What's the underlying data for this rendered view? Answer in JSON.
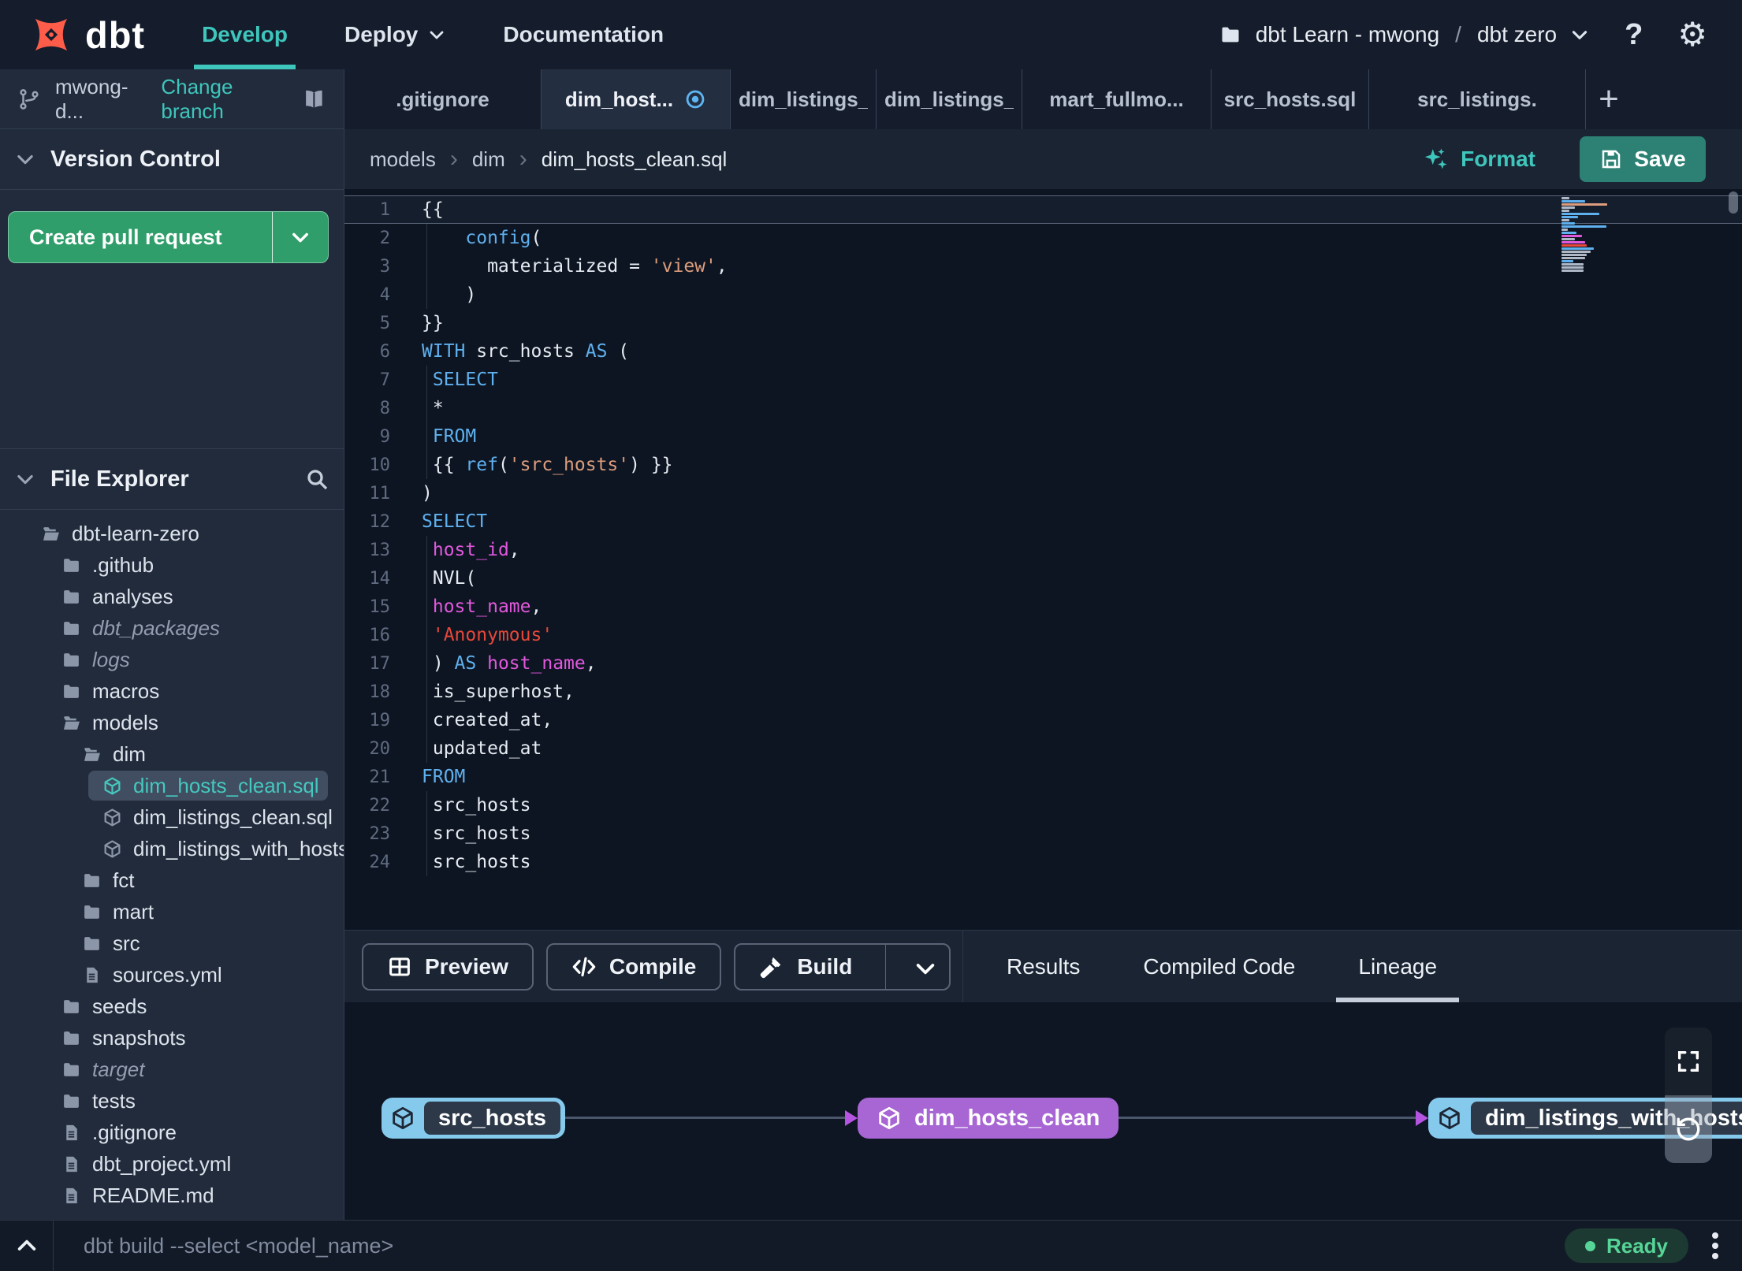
{
  "colors": {
    "accent_teal": "#3fc6bc",
    "green_button": "#2f9e6a",
    "save_teal": "#2c8174",
    "node_blue": "#85c9ec",
    "node_purple": "#a766d4",
    "edge_arrow_purple": "#b554e0",
    "syntax_keyword": "#5fb0ee",
    "syntax_string": "#dd9d7c",
    "syntax_red_string": "#e8483a",
    "syntax_identifier": "#e158dd",
    "status_green": "#57d598",
    "modified_dot_blue": "#5db6f2"
  },
  "topnav": {
    "logo_text": "dbt",
    "nav_items": [
      {
        "label": "Develop",
        "active": true
      },
      {
        "label": "Deploy",
        "chevron": true
      },
      {
        "label": "Documentation"
      }
    ],
    "project_selector": {
      "account": "dbt Learn - mwong",
      "separator": "/",
      "project": "dbt zero"
    },
    "help_label": "?"
  },
  "sidebar": {
    "branch": {
      "name": "mwong-d...",
      "change_branch": "Change branch"
    },
    "version_control": {
      "title": "Version Control",
      "create_pr": "Create pull request"
    },
    "file_explorer": {
      "title": "File Explorer",
      "tree": [
        {
          "label": "dbt-learn-zero",
          "type": "folder-open",
          "level": 0
        },
        {
          "label": ".github",
          "type": "folder",
          "level": 1
        },
        {
          "label": "analyses",
          "type": "folder",
          "level": 1
        },
        {
          "label": "dbt_packages",
          "type": "folder",
          "level": 1,
          "muted": true
        },
        {
          "label": "logs",
          "type": "folder",
          "level": 1,
          "muted": true
        },
        {
          "label": "macros",
          "type": "folder",
          "level": 1
        },
        {
          "label": "models",
          "type": "folder-open",
          "level": 1
        },
        {
          "label": "dim",
          "type": "folder-open",
          "level": 2
        },
        {
          "label": "dim_hosts_clean.sql",
          "type": "model",
          "level": 3,
          "selected": true,
          "modified": true
        },
        {
          "label": "dim_listings_clean.sql",
          "type": "model",
          "level": 3
        },
        {
          "label": "dim_listings_with_hosts...",
          "type": "model",
          "level": 3
        },
        {
          "label": "fct",
          "type": "folder",
          "level": 2
        },
        {
          "label": "mart",
          "type": "folder",
          "level": 2
        },
        {
          "label": "src",
          "type": "folder",
          "level": 2
        },
        {
          "label": "sources.yml",
          "type": "file",
          "level": 2
        },
        {
          "label": "seeds",
          "type": "folder",
          "level": 1
        },
        {
          "label": "snapshots",
          "type": "folder",
          "level": 1
        },
        {
          "label": "target",
          "type": "folder",
          "level": 1,
          "muted": true
        },
        {
          "label": "tests",
          "type": "folder",
          "level": 1
        },
        {
          "label": ".gitignore",
          "type": "file",
          "level": 1
        },
        {
          "label": "dbt_project.yml",
          "type": "file",
          "level": 1
        },
        {
          "label": "README.md",
          "type": "file",
          "level": 1
        }
      ]
    }
  },
  "editor_tabs": {
    "add_label": "+",
    "tabs": [
      {
        "label": ".gitignore"
      },
      {
        "label": "dim_host...",
        "active": true,
        "modified": true
      },
      {
        "label": "dim_listings_..."
      },
      {
        "label": "dim_listings_..."
      },
      {
        "label": "mart_fullmo..."
      },
      {
        "label": "src_hosts.sql"
      },
      {
        "label": "src_listings."
      }
    ]
  },
  "editor": {
    "breadcrumb": [
      "models",
      "dim",
      "dim_hosts_clean.sql"
    ],
    "breadcrumb_separator": "›",
    "format_label": "Format",
    "save_label": "Save",
    "code_lines": [
      {
        "num": 1,
        "current": true,
        "tokens": [
          {
            "t": "{{",
            "c": "plain"
          }
        ]
      },
      {
        "num": 2,
        "tokens": [
          {
            "t": "    ",
            "c": "plain"
          },
          {
            "t": "config",
            "c": "kw"
          },
          {
            "t": "(",
            "c": "plain"
          }
        ]
      },
      {
        "num": 3,
        "tokens": [
          {
            "t": "      materialized = ",
            "c": "plain"
          },
          {
            "t": "'view'",
            "c": "str"
          },
          {
            "t": ",",
            "c": "plain"
          }
        ]
      },
      {
        "num": 4,
        "tokens": [
          {
            "t": "    )",
            "c": "plain"
          }
        ]
      },
      {
        "num": 5,
        "tokens": [
          {
            "t": "}}",
            "c": "plain"
          }
        ]
      },
      {
        "num": 6,
        "tokens": [
          {
            "t": "WITH",
            "c": "kw"
          },
          {
            "t": " src_hosts ",
            "c": "plain"
          },
          {
            "t": "AS",
            "c": "kw"
          },
          {
            "t": " (",
            "c": "plain"
          }
        ]
      },
      {
        "num": 7,
        "tokens": [
          {
            "t": " ",
            "c": "plain"
          },
          {
            "t": "SELECT",
            "c": "kw"
          }
        ]
      },
      {
        "num": 8,
        "tokens": [
          {
            "t": " *",
            "c": "plain"
          }
        ]
      },
      {
        "num": 9,
        "tokens": [
          {
            "t": " ",
            "c": "plain"
          },
          {
            "t": "FROM",
            "c": "kw"
          }
        ]
      },
      {
        "num": 10,
        "tokens": [
          {
            "t": " {{ ",
            "c": "plain"
          },
          {
            "t": "ref",
            "c": "kw"
          },
          {
            "t": "(",
            "c": "plain"
          },
          {
            "t": "'src_hosts'",
            "c": "str"
          },
          {
            "t": ") }}",
            "c": "plain"
          }
        ]
      },
      {
        "num": 11,
        "tokens": [
          {
            "t": ")",
            "c": "plain"
          }
        ]
      },
      {
        "num": 12,
        "tokens": [
          {
            "t": "SELECT",
            "c": "kw"
          }
        ]
      },
      {
        "num": 13,
        "tokens": [
          {
            "t": " ",
            "c": "plain"
          },
          {
            "t": "host_id",
            "c": "ident"
          },
          {
            "t": ",",
            "c": "plain"
          }
        ]
      },
      {
        "num": 14,
        "tokens": [
          {
            "t": " NVL(",
            "c": "plain"
          }
        ]
      },
      {
        "num": 15,
        "tokens": [
          {
            "t": " ",
            "c": "plain"
          },
          {
            "t": "host_name",
            "c": "ident"
          },
          {
            "t": ",",
            "c": "plain"
          }
        ]
      },
      {
        "num": 16,
        "tokens": [
          {
            "t": " ",
            "c": "plain"
          },
          {
            "t": "'Anonymous'",
            "c": "red"
          }
        ]
      },
      {
        "num": 17,
        "tokens": [
          {
            "t": " ) ",
            "c": "plain"
          },
          {
            "t": "AS",
            "c": "kw"
          },
          {
            "t": " ",
            "c": "plain"
          },
          {
            "t": "host_name",
            "c": "ident"
          },
          {
            "t": ",",
            "c": "plain"
          }
        ]
      },
      {
        "num": 18,
        "tokens": [
          {
            "t": " is_superhost,",
            "c": "plain"
          }
        ]
      },
      {
        "num": 19,
        "tokens": [
          {
            "t": " created_at,",
            "c": "plain"
          }
        ]
      },
      {
        "num": 20,
        "tokens": [
          {
            "t": " updated_at",
            "c": "plain"
          }
        ]
      },
      {
        "num": 21,
        "tokens": [
          {
            "t": "FROM",
            "c": "kw"
          }
        ]
      },
      {
        "num": 22,
        "tokens": [
          {
            "t": " src_hosts",
            "c": "plain"
          }
        ]
      },
      {
        "num": 23,
        "tokens": [
          {
            "t": " src_hosts",
            "c": "plain"
          }
        ]
      },
      {
        "num": 24,
        "tokens": [
          {
            "t": " src_hosts",
            "c": "plain"
          }
        ]
      }
    ]
  },
  "bottom_panel": {
    "actions": [
      {
        "label": "Preview",
        "icon": "table-icon"
      },
      {
        "label": "Compile",
        "icon": "code-icon"
      },
      {
        "label": "Build",
        "icon": "hammer-icon",
        "split": true
      }
    ],
    "tabs": [
      {
        "label": "Results"
      },
      {
        "label": "Compiled Code"
      },
      {
        "label": "Lineage",
        "active": true
      }
    ],
    "lineage": {
      "nodes": [
        {
          "label": "src_hosts",
          "style": "blue"
        },
        {
          "label": "dim_hosts_clean",
          "style": "purple"
        },
        {
          "label": "dim_listings_with_hosts",
          "style": "blue"
        }
      ]
    }
  },
  "statusbar": {
    "command": "dbt build --select <model_name>",
    "status_label": "Ready"
  }
}
